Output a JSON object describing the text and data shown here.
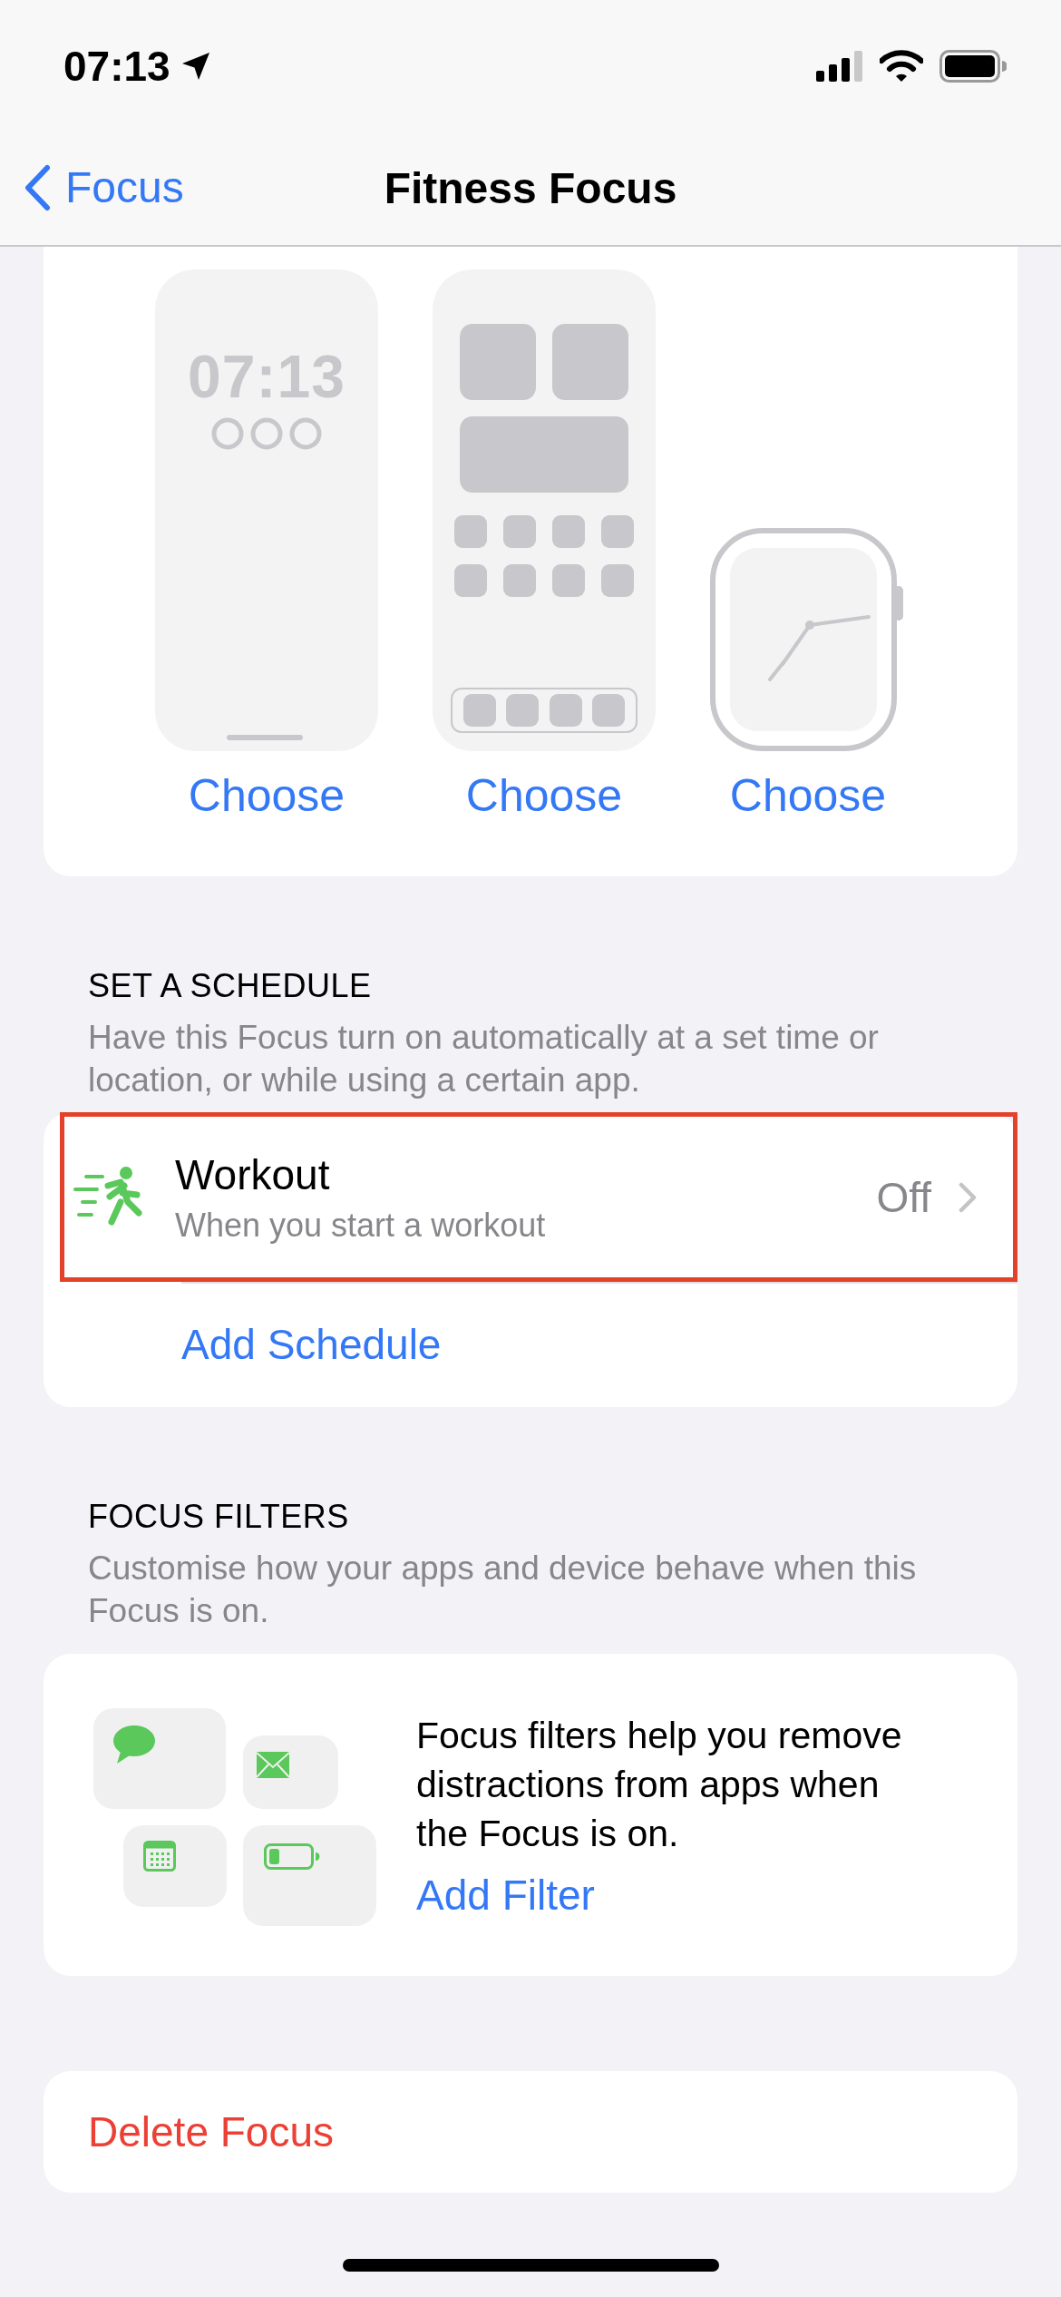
{
  "status_bar": {
    "time": "07:13"
  },
  "nav": {
    "back_label": "Focus",
    "title": "Fitness Focus"
  },
  "screens": [
    {
      "kind": "lock",
      "time": "07:13",
      "action": "Choose"
    },
    {
      "kind": "home",
      "action": "Choose"
    },
    {
      "kind": "watch",
      "action": "Choose"
    }
  ],
  "schedule": {
    "heading": "SET A SCHEDULE",
    "description": "Have this Focus turn on automatically at a set time or location, or while using a certain app.",
    "items": [
      {
        "title": "Workout",
        "subtitle": "When you start a workout",
        "value": "Off",
        "highlighted": true
      }
    ],
    "add_label": "Add Schedule"
  },
  "filters": {
    "heading": "FOCUS FILTERS",
    "description": "Customise how your apps and device behave when this Focus is on.",
    "text": "Focus filters help you remove distractions from apps when the Focus is on.",
    "add_label": "Add Filter"
  },
  "delete_label": "Delete Focus"
}
